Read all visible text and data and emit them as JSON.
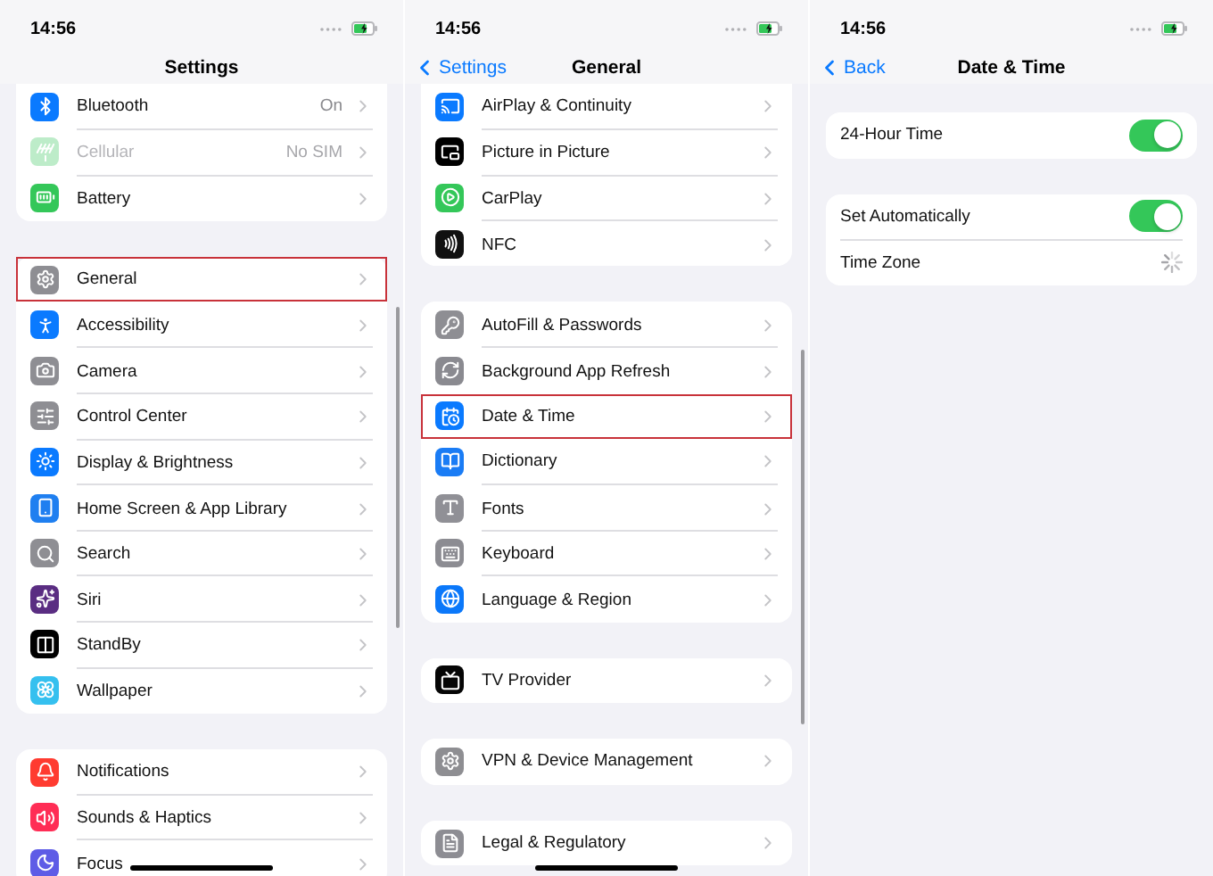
{
  "screens": [
    {
      "time": "14:56",
      "title": "Settings",
      "groups": [
        {
          "cut_top": true,
          "rows": [
            {
              "kind": "link",
              "label": "Bluetooth",
              "detail": "On",
              "color": "#0a7aff",
              "disabled": false,
              "selected": false
            },
            {
              "kind": "link",
              "label": "Cellular",
              "detail": "No SIM",
              "color": "#bdecc9",
              "disabled": true,
              "selected": false
            },
            {
              "kind": "link",
              "label": "Battery",
              "color": "#34c759",
              "disabled": false,
              "selected": false
            }
          ]
        },
        {
          "cut_top": false,
          "rows": [
            {
              "kind": "link",
              "label": "General",
              "color": "#8e8e93",
              "disabled": false,
              "selected": true
            },
            {
              "kind": "link",
              "label": "Accessibility",
              "color": "#0a7aff",
              "disabled": false,
              "selected": false
            },
            {
              "kind": "link",
              "label": "Camera",
              "color": "#8e8e93",
              "disabled": false,
              "selected": false
            },
            {
              "kind": "link",
              "label": "Control Center",
              "color": "#8e8e93",
              "disabled": false,
              "selected": false
            },
            {
              "kind": "link",
              "label": "Display & Brightness",
              "color": "#0a7aff",
              "disabled": false,
              "selected": false
            },
            {
              "kind": "link",
              "label": "Home Screen & App Library",
              "color": "#1f7ff0",
              "disabled": false,
              "selected": false
            },
            {
              "kind": "link",
              "label": "Search",
              "color": "#8e8e93",
              "disabled": false,
              "selected": false
            },
            {
              "kind": "link",
              "label": "Siri",
              "color": "#5a2d82",
              "disabled": false,
              "selected": false
            },
            {
              "kind": "link",
              "label": "StandBy",
              "color": "#000000",
              "disabled": false,
              "selected": false
            },
            {
              "kind": "link",
              "label": "Wallpaper",
              "color": "#35c0ef",
              "disabled": false,
              "selected": false
            }
          ]
        },
        {
          "cut_top": false,
          "rows": [
            {
              "kind": "link",
              "label": "Notifications",
              "color": "#ff3b30",
              "disabled": false,
              "selected": false
            },
            {
              "kind": "link",
              "label": "Sounds & Haptics",
              "color": "#ff2d55",
              "disabled": false,
              "selected": false
            },
            {
              "kind": "link",
              "label": "Focus",
              "color": "#5e5ce6",
              "disabled": false,
              "selected": false
            }
          ]
        }
      ]
    },
    {
      "time": "14:56",
      "title": "General",
      "back": "Settings",
      "groups": [
        {
          "cut_top": true,
          "rows": [
            {
              "kind": "link",
              "label": "AirPlay & Continuity",
              "color": "#0a7aff",
              "selected": false
            },
            {
              "kind": "link",
              "label": "Picture in Picture",
              "color": "#000000",
              "selected": false
            },
            {
              "kind": "link",
              "label": "CarPlay",
              "color": "#34c759",
              "selected": false
            },
            {
              "kind": "link",
              "label": "NFC",
              "color": "#111111",
              "selected": false
            }
          ]
        },
        {
          "cut_top": false,
          "rows": [
            {
              "kind": "link",
              "label": "AutoFill & Passwords",
              "color": "#8e8e93",
              "selected": false
            },
            {
              "kind": "link",
              "label": "Background App Refresh",
              "color": "#8a8a90",
              "selected": false
            },
            {
              "kind": "link",
              "label": "Date & Time",
              "color": "#0a7aff",
              "selected": true
            },
            {
              "kind": "link",
              "label": "Dictionary",
              "color": "#1a7cf5",
              "selected": false
            },
            {
              "kind": "link",
              "label": "Fonts",
              "color": "#909096",
              "selected": false
            },
            {
              "kind": "link",
              "label": "Keyboard",
              "color": "#8c8c92",
              "selected": false
            },
            {
              "kind": "link",
              "label": "Language & Region",
              "color": "#0b78fa",
              "selected": false
            }
          ]
        },
        {
          "cut_top": false,
          "rows": [
            {
              "kind": "link",
              "label": "TV Provider",
              "color": "#050505",
              "selected": false
            }
          ]
        },
        {
          "cut_top": false,
          "rows": [
            {
              "kind": "link",
              "label": "VPN & Device Management",
              "color": "#8e8e92",
              "selected": false
            }
          ]
        },
        {
          "cut_top": false,
          "rows": [
            {
              "kind": "link",
              "label": "Legal & Regulatory",
              "color": "#8d8d93",
              "selected": false
            }
          ]
        }
      ]
    },
    {
      "time": "14:56",
      "title": "Date & Time",
      "back": "Back",
      "groups": [
        {
          "cut_top": false,
          "rows": [
            {
              "kind": "toggle",
              "label": "24-Hour Time",
              "on": true
            }
          ]
        },
        {
          "cut_top": false,
          "rows": [
            {
              "kind": "toggle",
              "label": "Set Automatically",
              "on": true
            },
            {
              "kind": "loading",
              "label": "Time Zone"
            }
          ]
        }
      ]
    }
  ]
}
